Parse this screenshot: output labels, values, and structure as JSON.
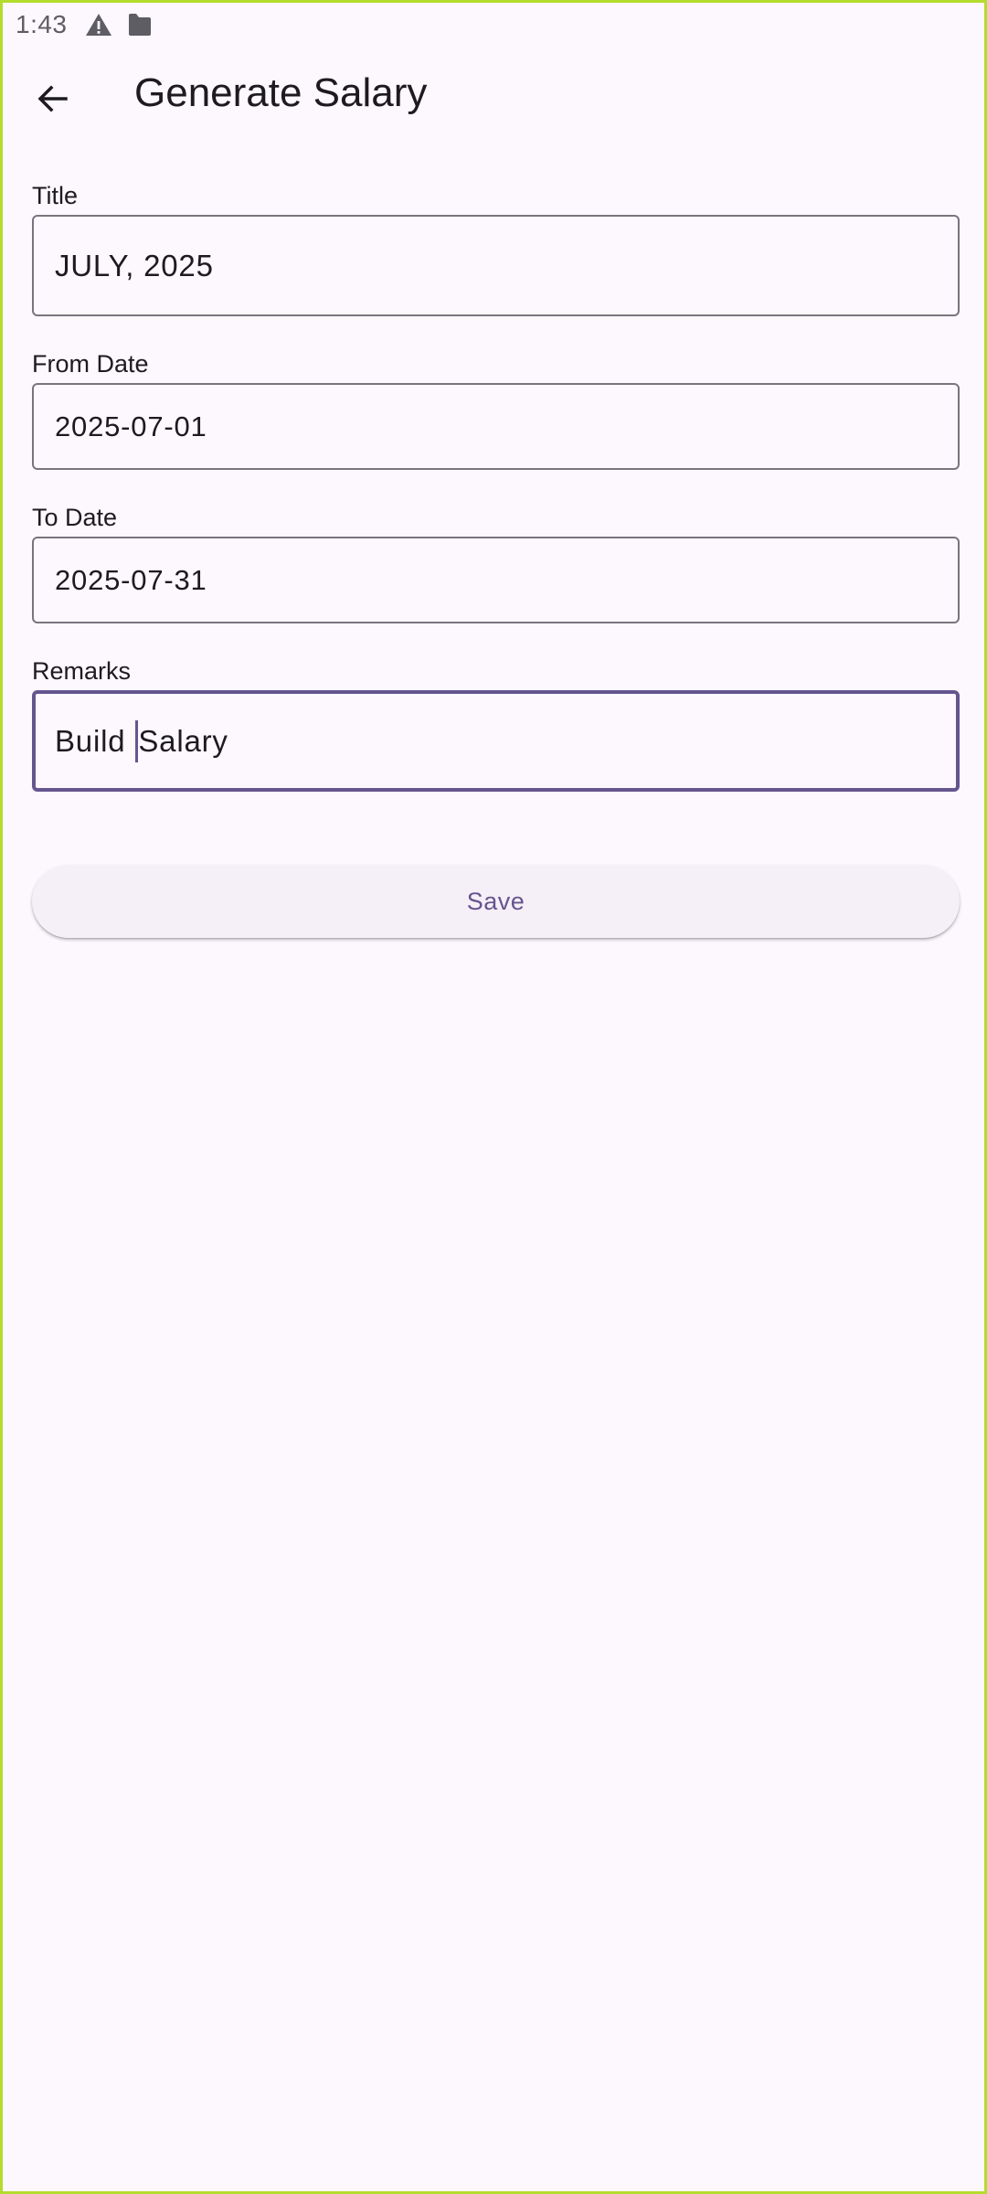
{
  "status_bar": {
    "time": "1:43",
    "icons": [
      "warning-icon",
      "sd-card-icon"
    ]
  },
  "app_bar": {
    "back_icon": "arrow-back-icon",
    "title": "Generate Salary"
  },
  "form": {
    "title": {
      "label": "Title",
      "value": "JULY, 2025"
    },
    "from_date": {
      "label": "From Date",
      "value": "2025-07-01"
    },
    "to_date": {
      "label": "To Date",
      "value": "2025-07-31"
    },
    "remarks": {
      "label": "Remarks",
      "value_before_cursor": "Build ",
      "value_after_cursor": "Salary"
    }
  },
  "save_button": {
    "label": "Save"
  },
  "colors": {
    "background": "#fdf7fe",
    "primary": "#65558f",
    "outline": "#79747e",
    "text": "#1d1b20"
  }
}
